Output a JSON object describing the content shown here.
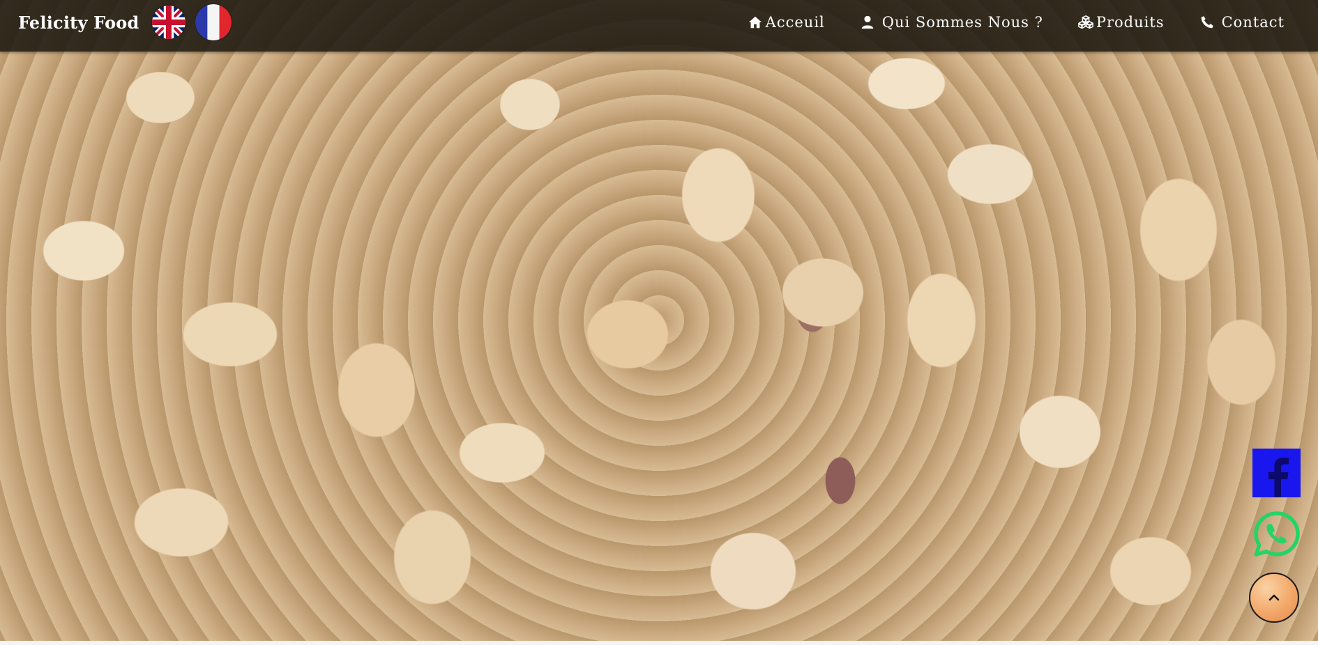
{
  "navbar": {
    "brand": "Felicity Food",
    "languages": [
      {
        "code": "en",
        "icon": "uk-flag-icon"
      },
      {
        "code": "fr",
        "icon": "france-flag-icon"
      }
    ],
    "links": [
      {
        "label": "Acceuil",
        "icon": "home-icon"
      },
      {
        "label": "Qui Sommes Nous ?",
        "icon": "user-icon"
      },
      {
        "label": "Produits",
        "icon": "cubes-icon"
      },
      {
        "label": "Contact",
        "icon": "phone-icon"
      }
    ]
  },
  "hero": {
    "image": "pistachios-background"
  },
  "floating": {
    "facebook_icon": "facebook-icon",
    "whatsapp_icon": "whatsapp-icon",
    "back_to_top_icon": "chevron-up-icon"
  },
  "colors": {
    "navbar_bg": "#1e1810",
    "facebook": "#1a16ee",
    "whatsapp": "#25d366",
    "back_to_top": "#f2a86a"
  }
}
